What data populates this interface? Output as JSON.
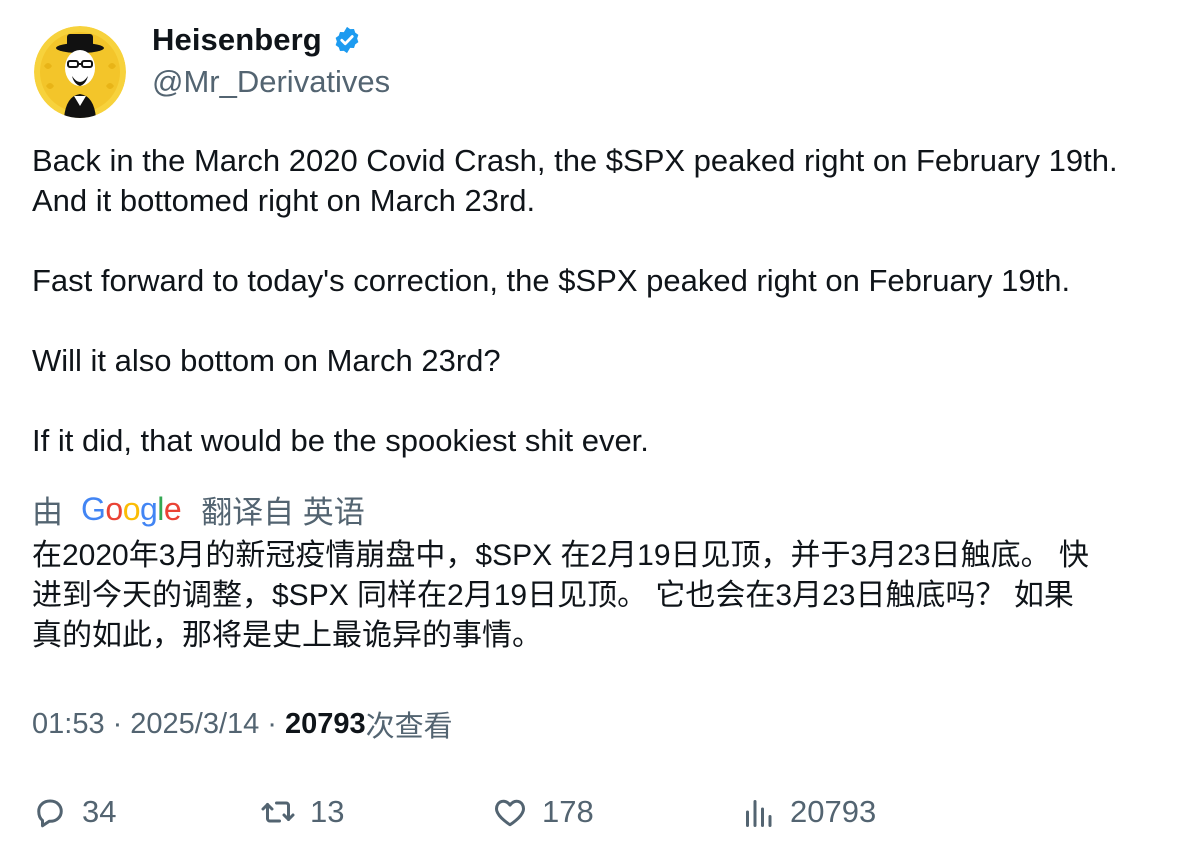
{
  "author": {
    "display_name": "Heisenberg",
    "handle": "@Mr_Derivatives",
    "verified": true
  },
  "tweet": {
    "paragraphs": [
      [
        "Back in the March 2020 Covid Crash, the $SPX peaked right on February 19th.",
        "And it bottomed right on March 23rd."
      ],
      [
        "Fast forward to today's correction, the $SPX peaked right on February 19th."
      ],
      [
        "Will it also bottom on March 23rd?"
      ],
      [
        "If it did, that would be the spookiest shit ever."
      ]
    ]
  },
  "translation": {
    "by_label": "由",
    "provider": "Google",
    "source_label": "翻译自 英语",
    "lines": [
      "在2020年3月的新冠疫情崩盘中，$SPX 在2月19日见顶，并于3月23日触底。 快",
      "进到今天的调整，$SPX 同样在2月19日见顶。 它也会在3月23日触底吗？ 如果",
      "真的如此，那将是史上最诡异的事情。"
    ]
  },
  "meta": {
    "time": "01:53",
    "date": "2025/3/14",
    "views_count": "20793",
    "views_label": "次查看",
    "separator": "·"
  },
  "actions": {
    "replies": "34",
    "reposts": "13",
    "likes": "178",
    "views": "20793"
  },
  "colors": {
    "text_primary": "#0f1419",
    "text_secondary": "#536471",
    "verified_blue": "#1d9bf0",
    "avatar_yellow": "#f7d23c"
  },
  "icons": {
    "reply": "reply-icon",
    "repost": "repost-icon",
    "like": "heart-icon",
    "views": "views-bar-icon",
    "verified": "verified-badge-icon"
  }
}
